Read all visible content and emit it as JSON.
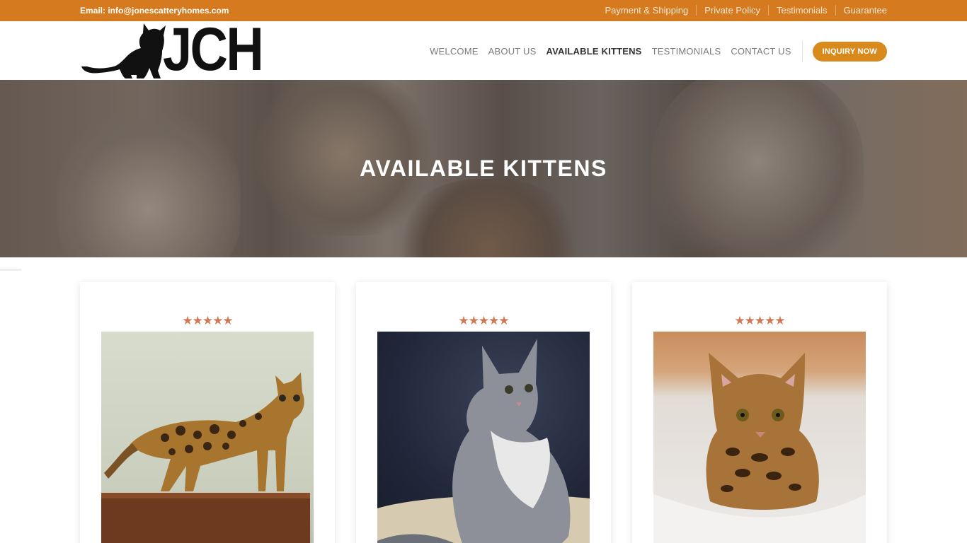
{
  "topbar": {
    "email": "Email: info@jonescatteryhomes.com",
    "links": [
      "Payment & Shipping",
      "Private Policy",
      "Testimonials",
      "Guarantee"
    ]
  },
  "header": {
    "logo_text": "JCH",
    "nav": [
      "WELCOME",
      "ABOUT US",
      "AVAILABLE KITTENS",
      "TESTIMONIALS",
      "CONTACT US"
    ],
    "cta": "INQUIRY NOW"
  },
  "hero": {
    "title": "AVAILABLE KITTENS"
  },
  "cards": [
    {
      "stars": "★★★★★"
    },
    {
      "stars": "★★★★★"
    },
    {
      "stars": "★★★★★"
    }
  ],
  "colors": {
    "accent": "#d57a1f",
    "button": "#d88a1c",
    "stars": "#d07a55"
  }
}
